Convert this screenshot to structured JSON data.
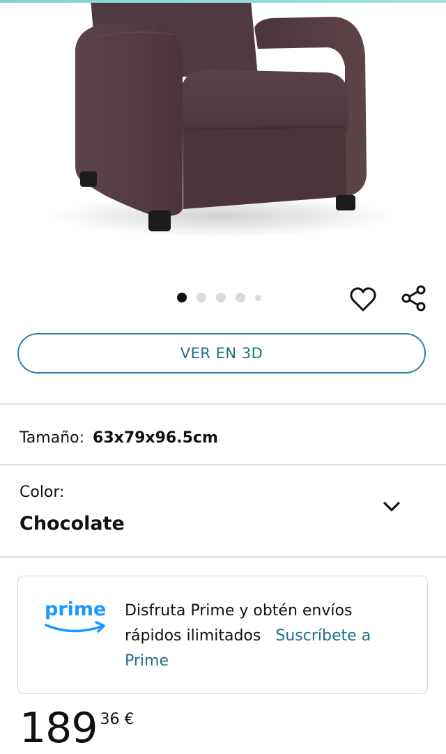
{
  "product": {
    "image_icon": "armchair-recliner-image",
    "carousel": {
      "total": 5,
      "active_index": 0
    },
    "color_accent": "#2d7f9a"
  },
  "actions": {
    "wishlist_icon": "heart-icon",
    "share_icon": "share-icon",
    "view_3d_label": "VER EN 3D"
  },
  "variation": {
    "size_label": "Tamaño:",
    "size_value": "63x79x96.5cm",
    "color_label": "Color:",
    "color_value": "Chocolate",
    "color_dropdown_icon": "chevron-down-icon"
  },
  "prime": {
    "logo_text": "prime",
    "text": "Disfruta Prime y obtén envíos rápidos ilimitados",
    "link_label": "Suscríbete a Prime",
    "brand_color": "#1a98ff"
  },
  "price": {
    "whole": "189",
    "fraction": "36",
    "currency": "€"
  }
}
